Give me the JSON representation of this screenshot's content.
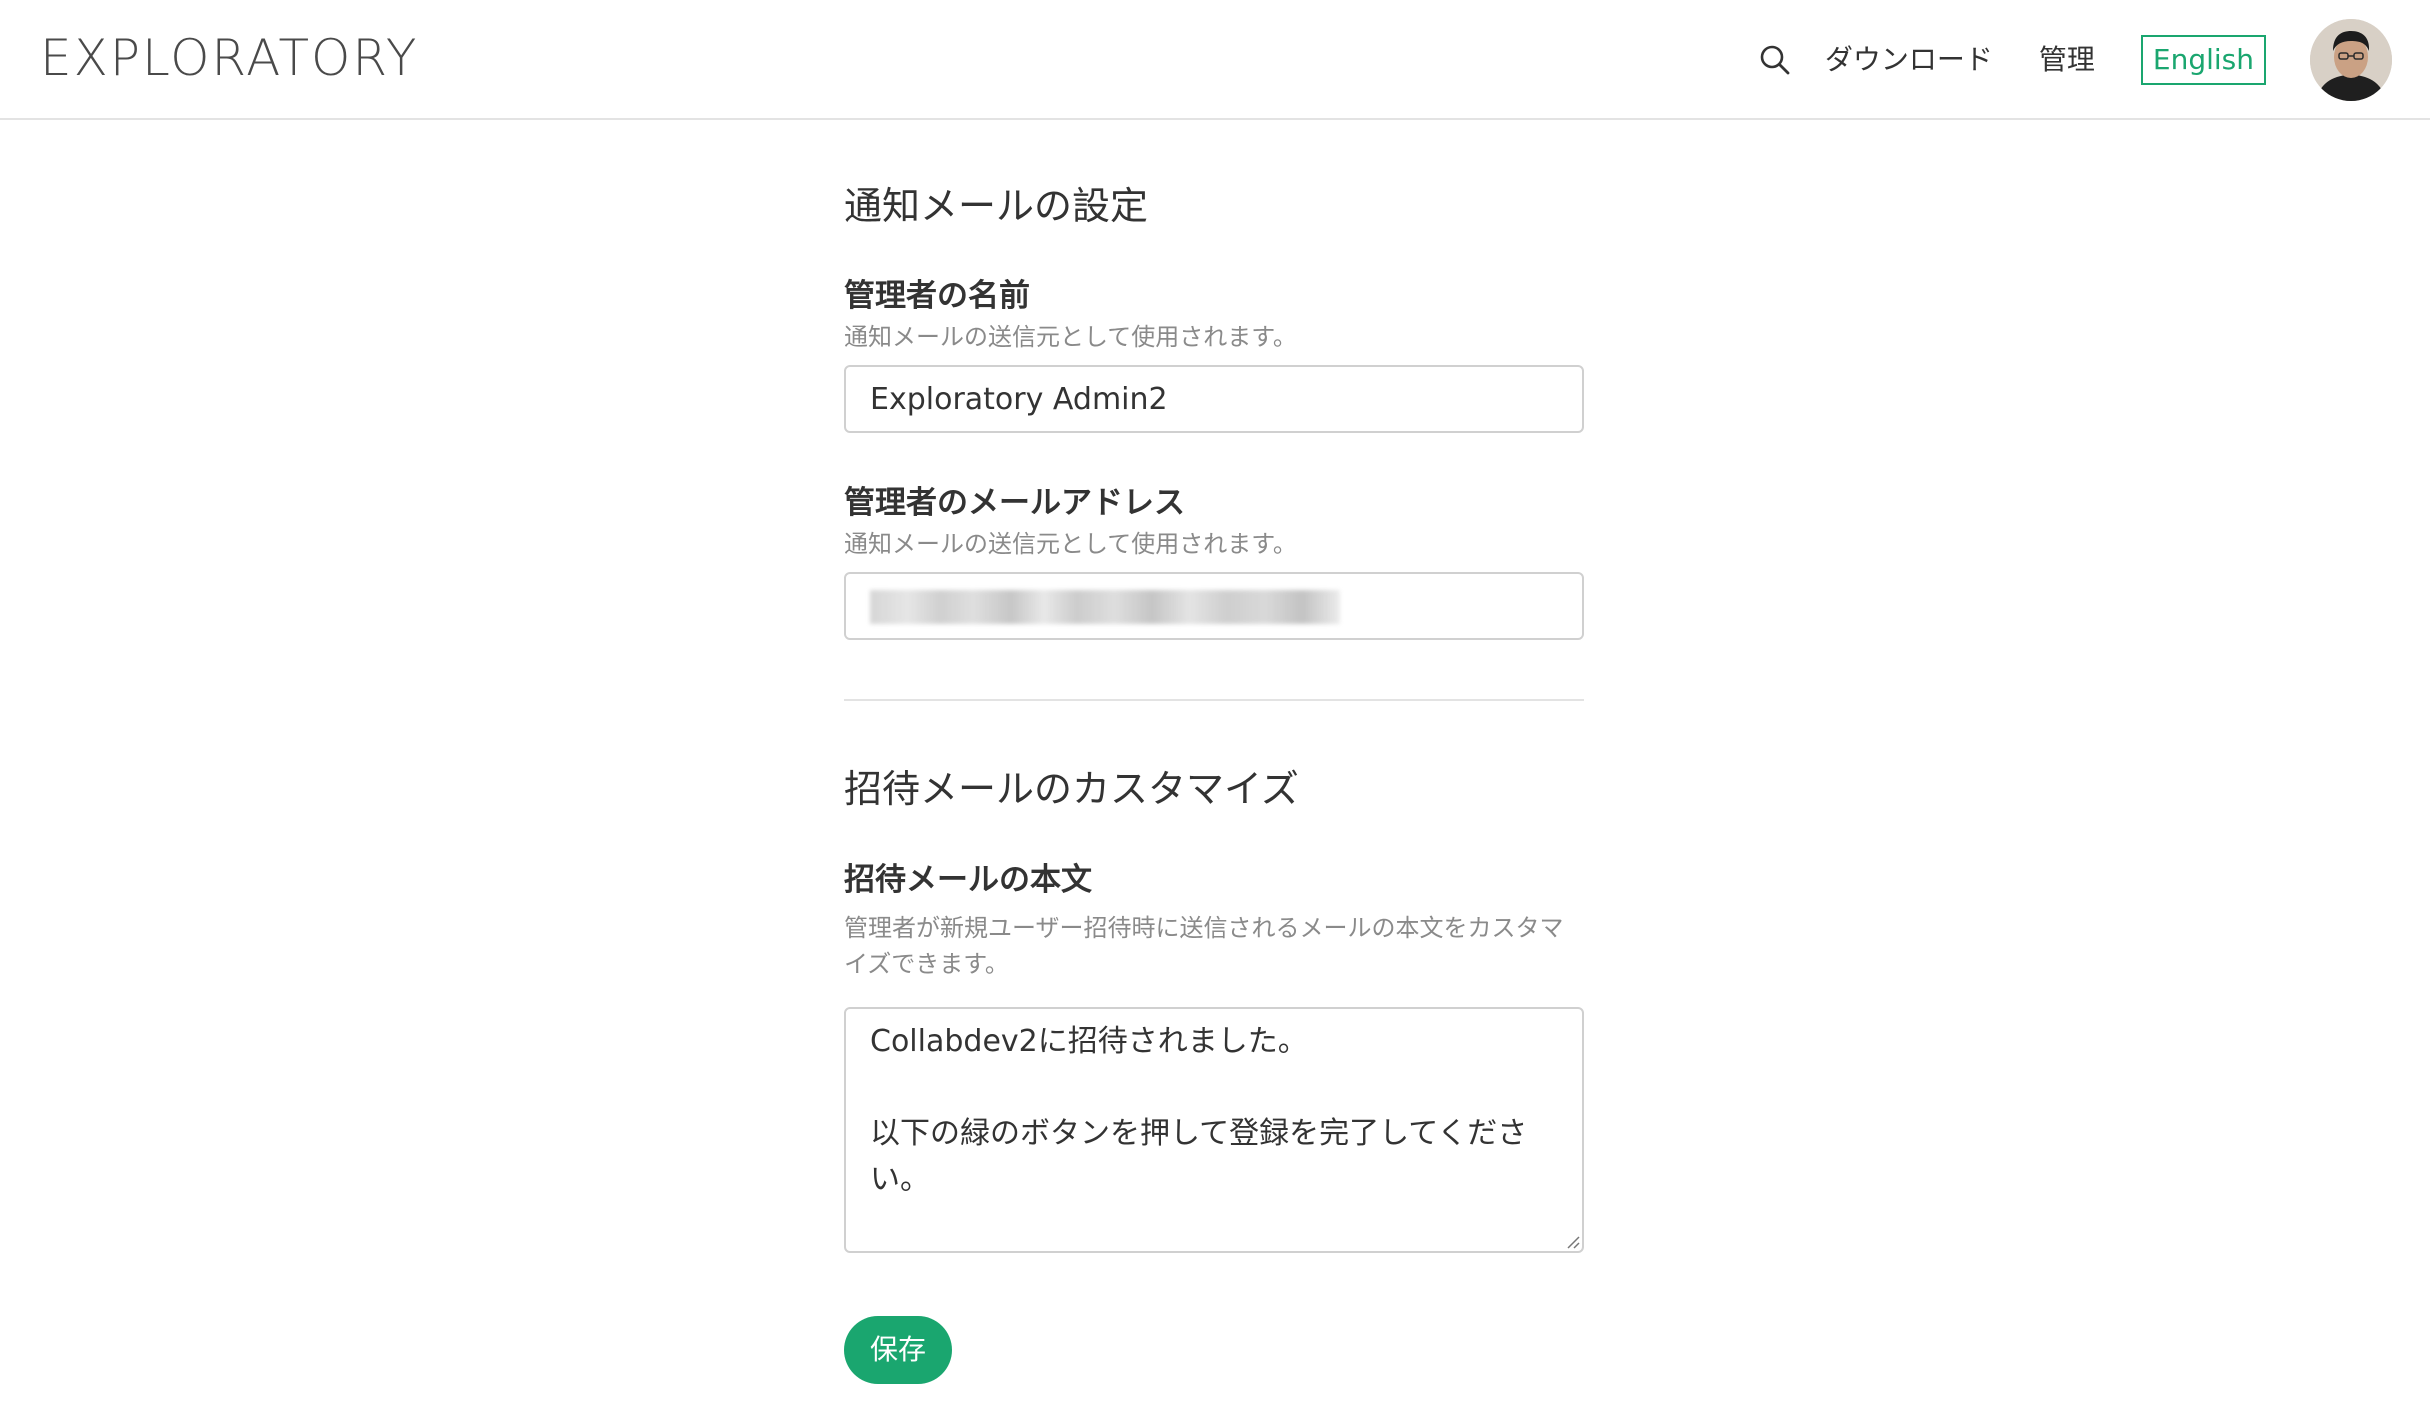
{
  "header": {
    "logo": "EXPLORATORY",
    "nav": {
      "download": "ダウンロード",
      "admin": "管理",
      "language": "English"
    }
  },
  "notification": {
    "title": "通知メールの設定",
    "admin_name": {
      "label": "管理者の名前",
      "help": "通知メールの送信元として使用されます。",
      "value": "Exploratory Admin2"
    },
    "admin_email": {
      "label": "管理者のメールアドレス",
      "help": "通知メールの送信元として使用されます。"
    }
  },
  "invite": {
    "title": "招待メールのカスタマイズ",
    "body": {
      "label": "招待メールの本文",
      "help": "管理者が新規ユーザー招待時に送信されるメールの本文をカスタマイズできます。",
      "value": "Collabdev2に招待されました。\n\n以下の緑のボタンを押して登録を完了してください。"
    }
  },
  "actions": {
    "save_label": "保存"
  },
  "colors": {
    "accent": "#1aa66f",
    "text": "#333333",
    "muted": "#8a8a8a",
    "border": "#d0d0d0"
  }
}
